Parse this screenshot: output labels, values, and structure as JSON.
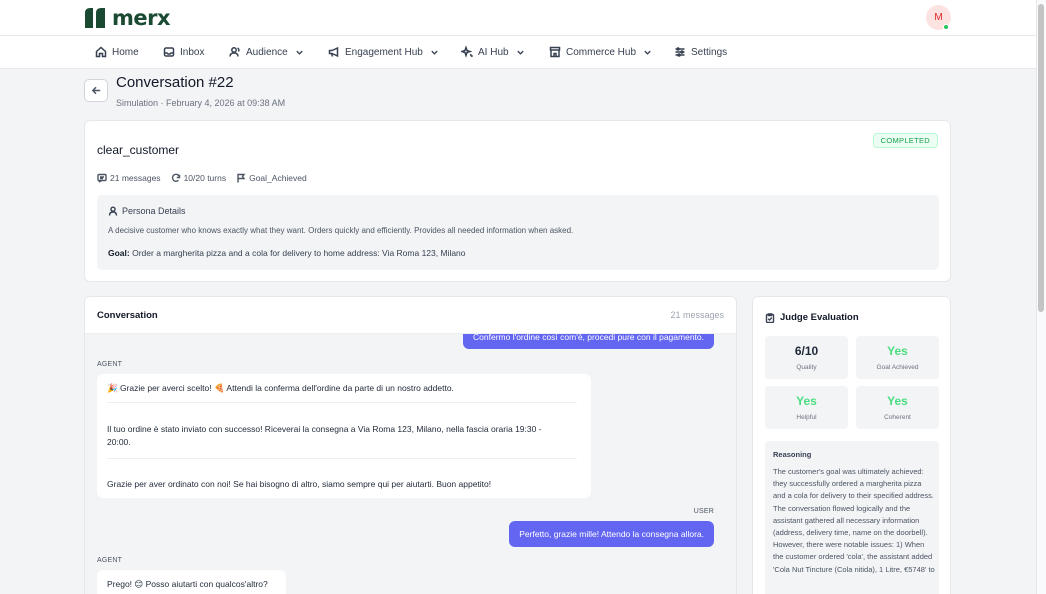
{
  "app": {
    "logo_text": "merx",
    "avatar_initial": "M",
    "brand_color": "#1a4a32"
  },
  "nav": {
    "items": [
      {
        "label": "Home",
        "icon": "home-icon",
        "dropdown": false
      },
      {
        "label": "Inbox",
        "icon": "inbox-icon",
        "dropdown": false
      },
      {
        "label": "Audience",
        "icon": "users-icon",
        "dropdown": true
      },
      {
        "label": "Engagement Hub",
        "icon": "megaphone-icon",
        "dropdown": true
      },
      {
        "label": "AI Hub",
        "icon": "sparkles-icon",
        "dropdown": true
      },
      {
        "label": "Commerce Hub",
        "icon": "store-icon",
        "dropdown": true
      },
      {
        "label": "Settings",
        "icon": "sliders-icon",
        "dropdown": false
      }
    ]
  },
  "header": {
    "title": "Conversation #22",
    "subtitle": "Simulation · February 4, 2026 at 09:38 AM"
  },
  "summary": {
    "status": "COMPLETED",
    "status_color": "#16a34a",
    "persona_name": "clear_customer",
    "messages": "21 messages",
    "turns": "10/20 turns",
    "outcome": "Goal_Achieved",
    "persona_section_title": "Persona Details",
    "persona_description": "A decisive customer who knows exactly what they want. Orders quickly and efficiently. Provides all needed information when asked.",
    "goal_label": "Goal:",
    "goal_text": "Order a margherita pizza and a cola for delivery to home address: Via Roma 123, Milano"
  },
  "conversation": {
    "title": "Conversation",
    "count": "21 messages",
    "user_color": "#6366f1",
    "messages": [
      {
        "role": "USER",
        "text": "Confermo l'ordine così com'è, procedi pure con il pagamento."
      },
      {
        "role": "AGENT",
        "lines": [
          "🎉 Grazie per averci scelto! 🍕 Attendi la conferma dell'ordine da parte di un nostro addetto.",
          "Il tuo ordine è stato inviato con successo! Riceverai la consegna a Via Roma 123, Milano, nella fascia oraria 19:30 -",
          "20:00.",
          "Grazie per aver ordinato con noi! Se hai bisogno di altro, siamo sempre qui per aiutarti. Buon appetito!"
        ]
      },
      {
        "role": "USER",
        "text": "Perfetto, grazie mille! Attendo la consegna allora."
      },
      {
        "role": "AGENT",
        "lines": [
          "Prego! 😊 Posso aiutarti con qualcos'altro?"
        ]
      }
    ]
  },
  "judge": {
    "title": "Judge Evaluation",
    "metrics": [
      {
        "value": "6/10",
        "label": "Quality",
        "color": "#1f2937"
      },
      {
        "value": "Yes",
        "label": "Goal Achieved",
        "color": "#4ade80"
      },
      {
        "value": "Yes",
        "label": "Helpful",
        "color": "#4ade80"
      },
      {
        "value": "Yes",
        "label": "Coherent",
        "color": "#4ade80"
      }
    ],
    "reasoning_title": "Reasoning",
    "reasoning_text": "The customer's goal was ultimately achieved: they successfully ordered a margherita pizza and a cola for delivery to their specified address. The conversation flowed logically and the assistant gathered all necessary information (address, delivery time, name on the doorbell). However, there were notable issues: 1) When the customer ordered 'cola', the assistant added 'Cola Nut Tincture (Cola nitida), 1 Litre, €5748' to"
  }
}
